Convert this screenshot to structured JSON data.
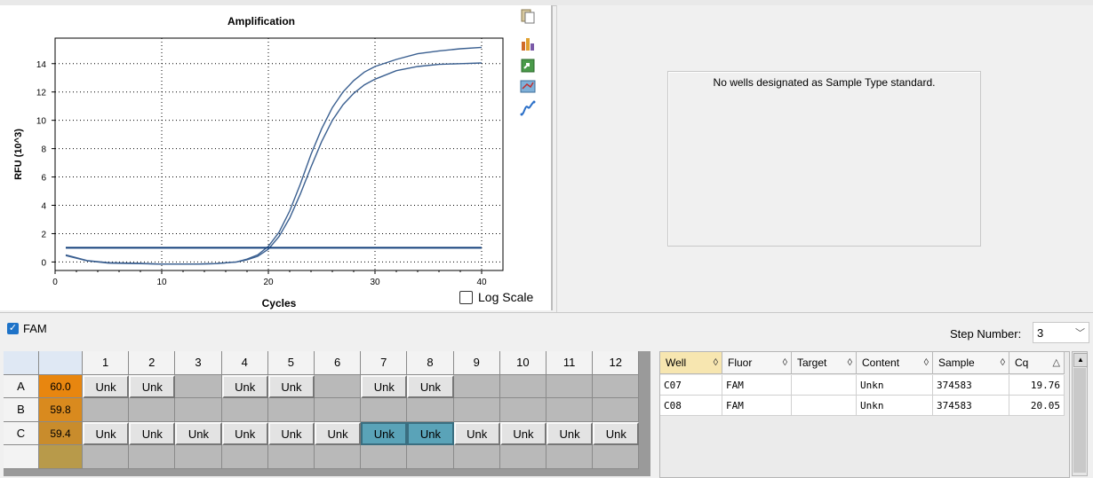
{
  "amplification": {
    "title": "Amplification",
    "xlabel": "Cycles",
    "ylabel": "RFU (10^3)",
    "log_scale_label": "Log Scale",
    "log_scale_checked": false,
    "toolbar_icons": [
      "copy-icon",
      "chart-settings-icon",
      "export-icon",
      "zoom-icon",
      "threshold-icon"
    ]
  },
  "chart_data": {
    "type": "line",
    "title": "Amplification",
    "xlabel": "Cycles",
    "ylabel": "RFU (10^3)",
    "xlim": [
      0,
      42
    ],
    "ylim": [
      -0.6,
      15.8
    ],
    "xticks": [
      0,
      10,
      20,
      30,
      40
    ],
    "yticks": [
      0,
      2,
      4,
      6,
      8,
      10,
      12,
      14
    ],
    "grid": "dotted",
    "series": [
      {
        "x": [
          1,
          3,
          5,
          8,
          10,
          13,
          15,
          17,
          18,
          19,
          20,
          21,
          22,
          23,
          24,
          25,
          26,
          27,
          28,
          29,
          30,
          32,
          34,
          36,
          38,
          40
        ],
        "y": [
          0.5,
          0.1,
          -0.05,
          -0.1,
          -0.15,
          -0.15,
          -0.12,
          0.0,
          0.2,
          0.5,
          1.1,
          2.1,
          3.6,
          5.5,
          7.6,
          9.4,
          10.9,
          12.0,
          12.8,
          13.4,
          13.8,
          14.3,
          14.7,
          14.9,
          15.05,
          15.15
        ],
        "color": "#3a5f90"
      },
      {
        "x": [
          1,
          3,
          5,
          8,
          10,
          13,
          15,
          17,
          18,
          19,
          20,
          21,
          22,
          23,
          24,
          25,
          26,
          27,
          28,
          29,
          30,
          32,
          34,
          36,
          38,
          40
        ],
        "y": [
          0.45,
          0.08,
          -0.08,
          -0.12,
          -0.15,
          -0.15,
          -0.12,
          0.0,
          0.15,
          0.4,
          0.9,
          1.8,
          3.1,
          4.8,
          6.7,
          8.5,
          10.0,
          11.1,
          11.9,
          12.5,
          12.9,
          13.5,
          13.8,
          13.95,
          14.0,
          14.05
        ],
        "color": "#3a5f90"
      },
      {
        "x": [
          1,
          40
        ],
        "y": [
          1.0,
          1.0
        ],
        "color": "#123f7a"
      }
    ]
  },
  "standard_curve": {
    "message": "No wells designated as Sample Type standard."
  },
  "fluor": {
    "label": "FAM",
    "checked": true
  },
  "step": {
    "label": "Step Number:",
    "value": "3"
  },
  "plate": {
    "columns": [
      "1",
      "2",
      "3",
      "4",
      "5",
      "6",
      "7",
      "8",
      "9",
      "10",
      "11",
      "12"
    ],
    "rows": [
      {
        "label": "A",
        "temp": "60.0",
        "temp_color": "#e8860f",
        "cells": [
          "Unk",
          "Unk",
          "",
          "Unk",
          "Unk",
          "",
          "Unk",
          "Unk",
          "",
          "",
          "",
          ""
        ]
      },
      {
        "label": "B",
        "temp": "59.8",
        "temp_color": "#d98a1e",
        "cells": [
          "",
          "",
          "",
          "",
          "",
          "",
          "",
          "",
          "",
          "",
          "",
          ""
        ]
      },
      {
        "label": "C",
        "temp": "59.4",
        "temp_color": "#c98c2c",
        "cells": [
          "Unk",
          "Unk",
          "Unk",
          "Unk",
          "Unk",
          "Unk",
          "Unk",
          "Unk",
          "Unk",
          "Unk",
          "Unk",
          "Unk"
        ]
      }
    ],
    "selected": [
      [
        2,
        6
      ],
      [
        2,
        7
      ]
    ]
  },
  "results": {
    "headers": [
      "Well",
      "Fluor",
      "Target",
      "Content",
      "Sample",
      "Cq"
    ],
    "rows": [
      {
        "well": "C07",
        "fluor": "FAM",
        "target": "",
        "content": "Unkn",
        "sample": "374583",
        "cq": "19.76"
      },
      {
        "well": "C08",
        "fluor": "FAM",
        "target": "",
        "content": "Unkn",
        "sample": "374583",
        "cq": "20.05"
      }
    ]
  }
}
